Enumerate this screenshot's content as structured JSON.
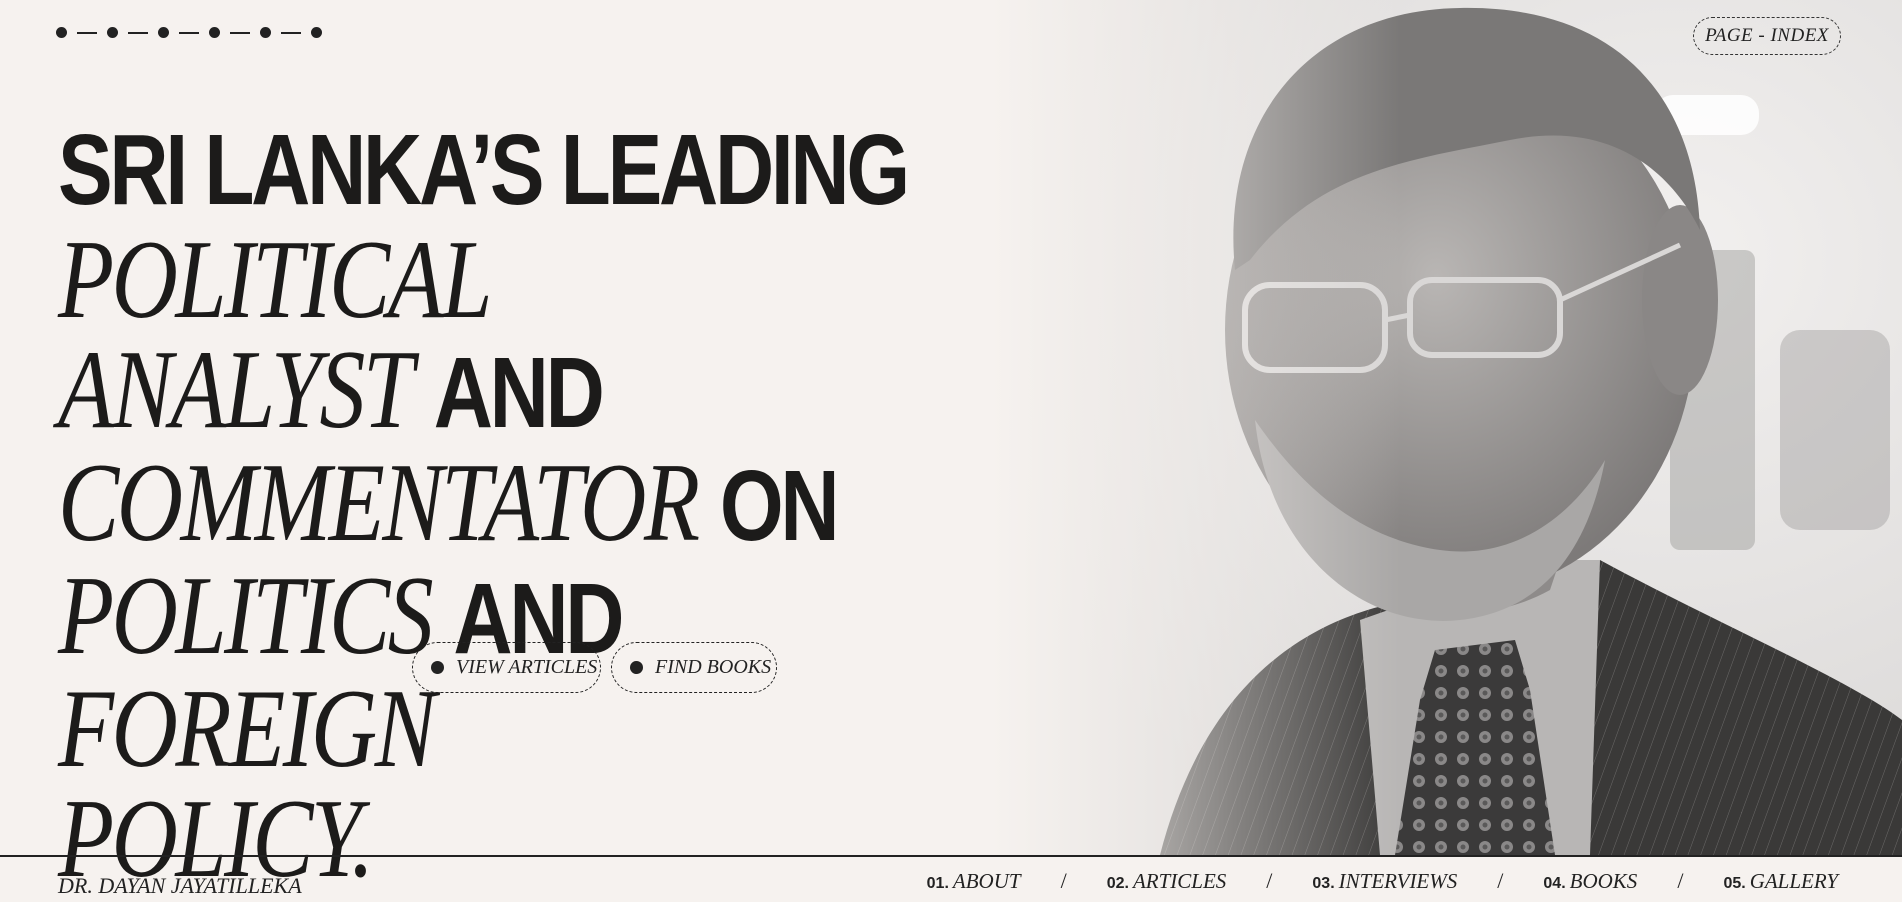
{
  "header": {
    "page_index_label": "PAGE - INDEX"
  },
  "headline": {
    "w1": "SRI LANKA’S LEADING",
    "w2": "POLITICAL",
    "w3": "ANALYST",
    "w4": "AND",
    "w5": "COMMENTATOR",
    "w6": "ON",
    "w7": "POLITICS",
    "w8": "AND",
    "w9": "FOREIGN",
    "w10": "POLICY."
  },
  "cta": {
    "articles_label": "VIEW ARTICLES",
    "books_label": "FIND BOOKS"
  },
  "footer": {
    "name": "DR. DAYAN JAYATILLEKA",
    "nav": [
      {
        "num": "01.",
        "label": "ABOUT"
      },
      {
        "num": "02.",
        "label": "ARTICLES"
      },
      {
        "num": "03.",
        "label": "INTERVIEWS"
      },
      {
        "num": "04.",
        "label": "BOOKS"
      },
      {
        "num": "05.",
        "label": "GALLERY"
      }
    ],
    "separator": "/"
  }
}
